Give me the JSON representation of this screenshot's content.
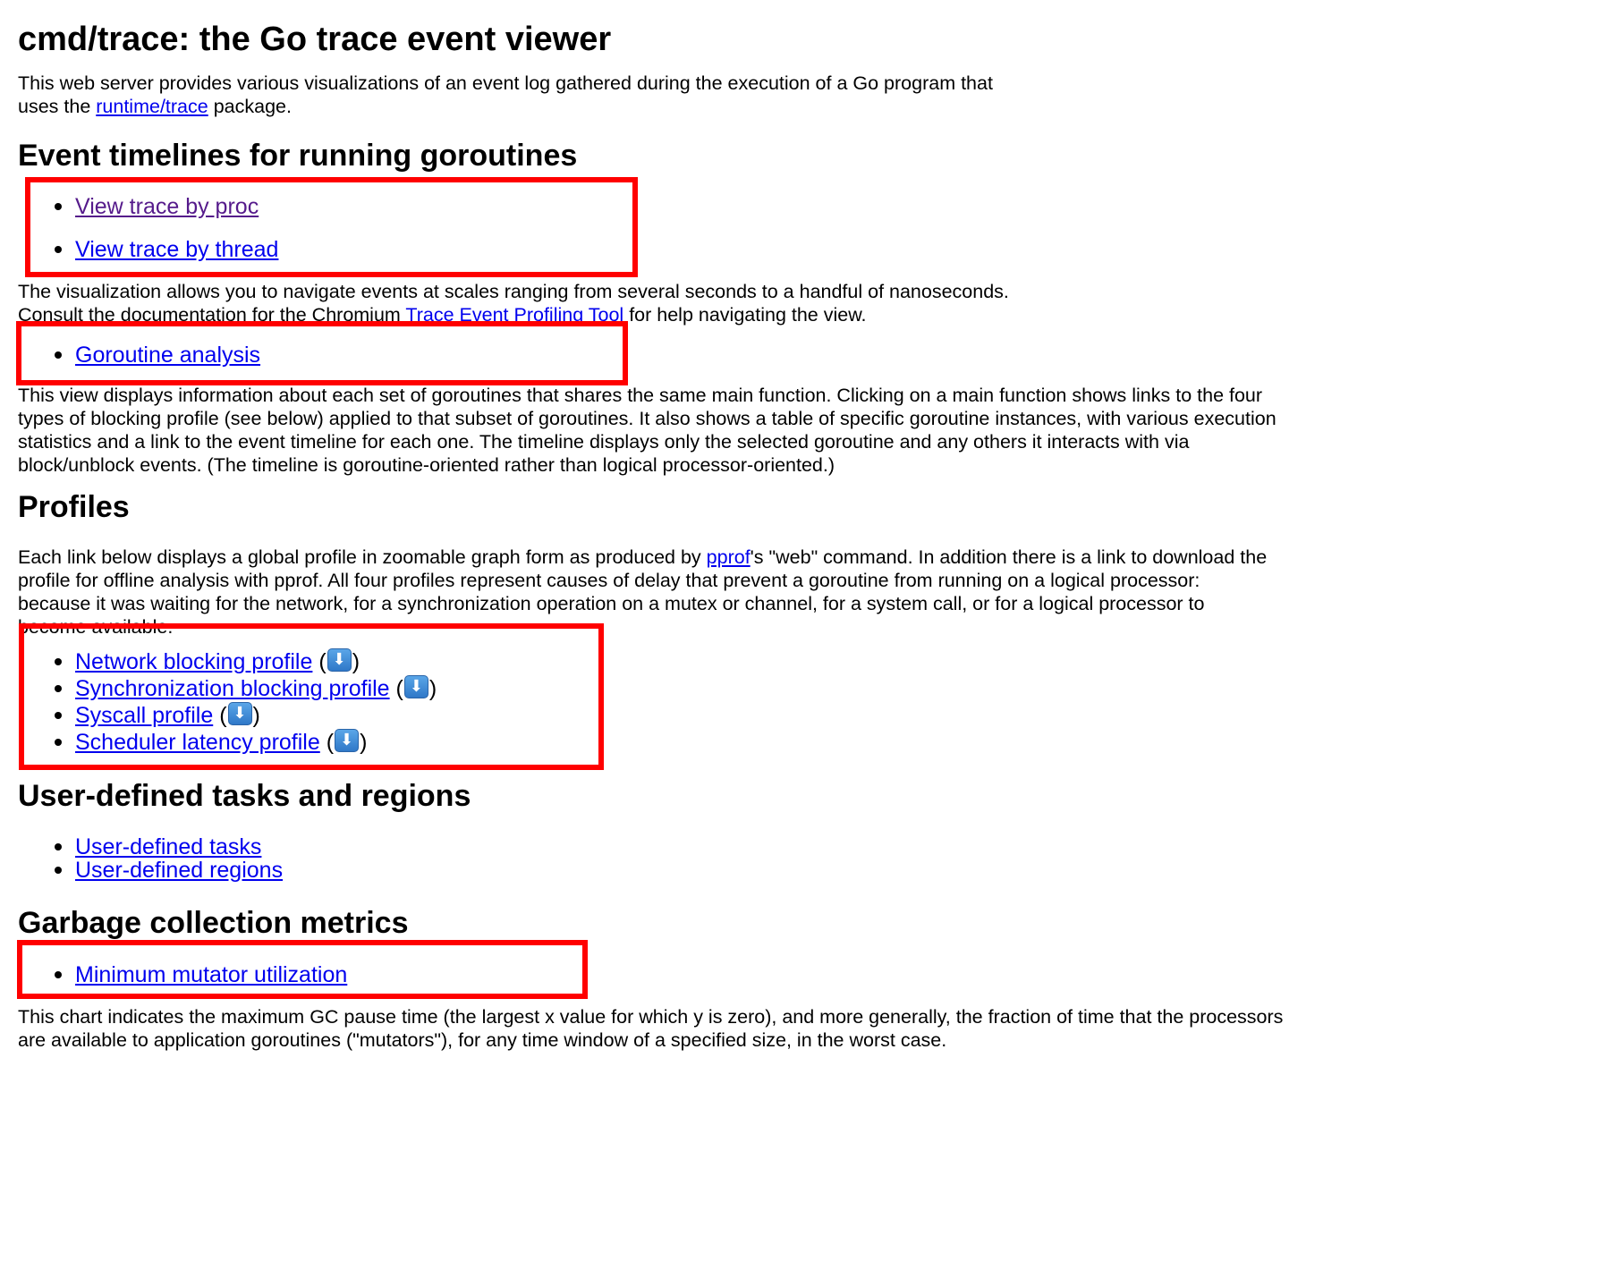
{
  "page_title": "cmd/trace: the Go trace event viewer",
  "intro": {
    "text_before": "This web server provides various visualizations of an event log gathered during the execution of a Go program that uses the ",
    "link": "runtime/trace",
    "text_after": " package."
  },
  "section_timelines": {
    "heading": "Event timelines for running goroutines",
    "links": [
      "View trace by proc",
      "View trace by thread"
    ],
    "desc_before": "The visualization allows you to navigate events at scales ranging from several seconds to a handful of nanoseconds. Consult the documentation for the Chromium ",
    "desc_link": "Trace Event Profiling Tool",
    "desc_after": " for help navigating the view."
  },
  "section_goroutine": {
    "link": "Goroutine analysis",
    "desc": "This view displays information about each set of goroutines that shares the same main function. Clicking on a main function shows links to the four types of blocking profile (see below) applied to that subset of goroutines. It also shows a table of specific goroutine instances, with various execution statistics and a link to the event timeline for each one. The timeline displays only the selected goroutine and any others it interacts with via block/unblock events. (The timeline is goroutine-oriented rather than logical processor-oriented.)"
  },
  "section_profiles": {
    "heading": "Profiles",
    "desc_before": "Each link below displays a global profile in zoomable graph form as produced by ",
    "desc_link": "pprof",
    "desc_after": "'s \"web\" command. In addition there is a link to download the profile for offline analysis with pprof. All four profiles represent causes of delay that prevent a goroutine from running on a logical processor: because it was waiting for the network, for a synchronization operation on a mutex or channel, for a system call, or for a logical processor to become available.",
    "open_paren": "(",
    "close_paren": ")",
    "links": [
      "Network blocking profile",
      "Synchronization blocking profile",
      "Syscall profile",
      "Scheduler latency profile"
    ]
  },
  "section_tasks": {
    "heading": "User-defined tasks and regions",
    "links": [
      "User-defined tasks",
      "User-defined regions"
    ]
  },
  "section_gc": {
    "heading": "Garbage collection metrics",
    "link": "Minimum mutator utilization",
    "desc": "This chart indicates the maximum GC pause time (the largest x value for which y is zero), and more generally, the fraction of time that the processors are available to application goroutines (\"mutators\"), for any time window of a specified size, in the worst case."
  },
  "colors": {
    "link": "#0000ee",
    "visited_link": "#551a8b",
    "highlight": "#ff0000"
  },
  "icons": {
    "download": "down-arrow-download-icon"
  }
}
